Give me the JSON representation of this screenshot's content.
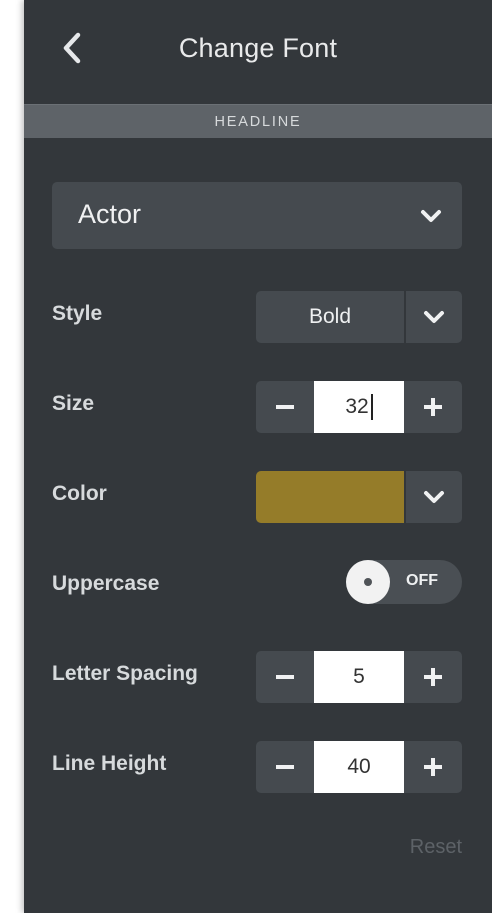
{
  "header": {
    "title": "Change Font"
  },
  "section": {
    "label": "HEADLINE"
  },
  "font_family": {
    "value": "Actor"
  },
  "style": {
    "label": "Style",
    "value": "Bold"
  },
  "size": {
    "label": "Size",
    "value": "32",
    "minus": "−",
    "plus": "+"
  },
  "color": {
    "label": "Color",
    "swatch_hex": "#957c29"
  },
  "uppercase": {
    "label": "Uppercase",
    "state": "OFF"
  },
  "letter_spacing": {
    "label": "Letter Spacing",
    "value": "5",
    "minus": "−",
    "plus": "+"
  },
  "line_height": {
    "label": "Line Height",
    "value": "40",
    "minus": "−",
    "plus": "+"
  },
  "footer": {
    "reset_label": "Reset"
  },
  "icons": {
    "back": "chevron-left-icon",
    "dropdown": "chevron-down-icon",
    "minus": "minus-icon",
    "plus": "plus-icon"
  }
}
